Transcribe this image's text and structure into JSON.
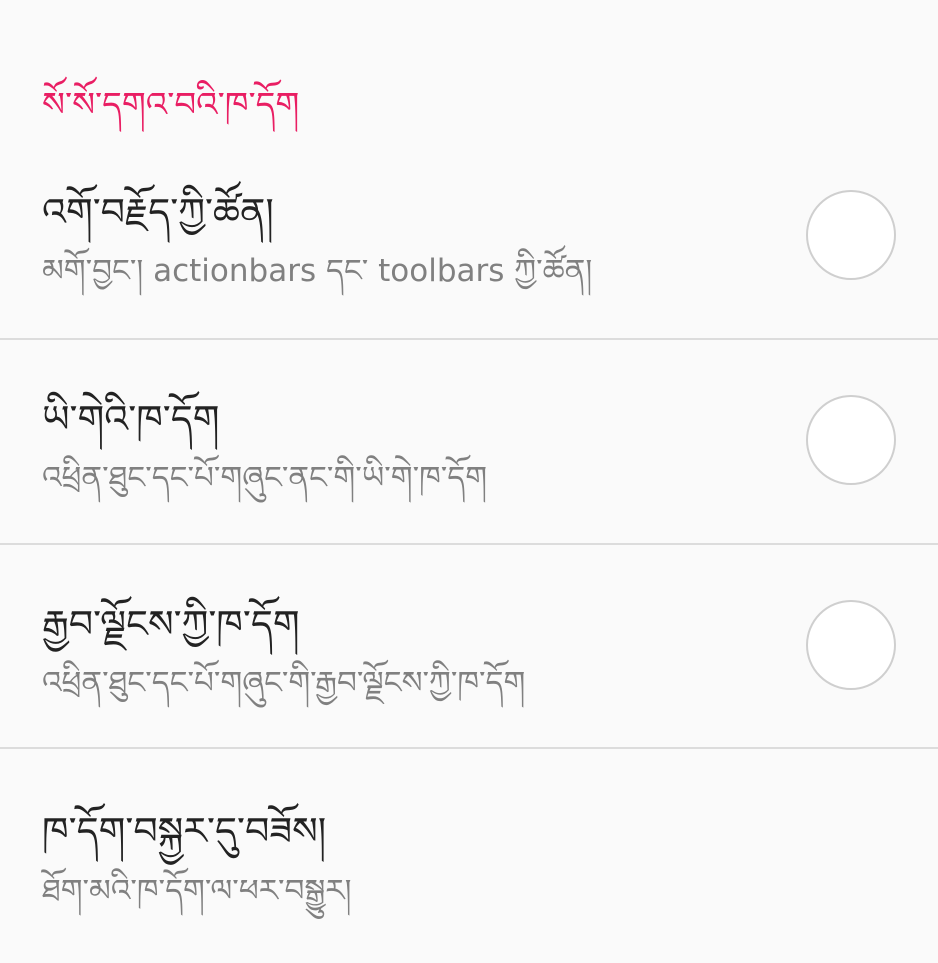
{
  "section": {
    "header": "སོ་སོ་དགའ་བའི་ཁ་དོག"
  },
  "options": [
    {
      "title": "འགོ་བརྗོད་ཀྱི་ཚོན།",
      "subtitle": "མགོ་བྱང་། actionbars དང་ toolbars ཀྱི་ཚོན།",
      "selected": false
    },
    {
      "title": "ཡི་གེའི་ཁ་དོག",
      "subtitle": "འཕྲིན་ཐུང་དང་པོ་གཞུང་ནང་གི་ཡི་གེ་ཁ་དོག",
      "selected": false
    },
    {
      "title": "རྒྱབ་ལྗོངས་ཀྱི་ཁ་དོག",
      "subtitle": "འཕྲིན་ཐུང་དང་པོ་གཞུང་གི་རྒྱབ་ལྗོངས་ཀྱི་ཁ་དོག",
      "selected": false
    },
    {
      "title": "ཁ་དོག་བསྐྱར་དུ་བཟོས།",
      "subtitle": "ཐོག་མའི་ཁ་དོག་ལ་ཕར་བསྒྱུར།"
    }
  ],
  "colors": {
    "accent": "#e91e63",
    "primary_text": "#222222",
    "secondary_text": "#808080",
    "divider": "#dcdcdc",
    "background": "#fafafa"
  }
}
